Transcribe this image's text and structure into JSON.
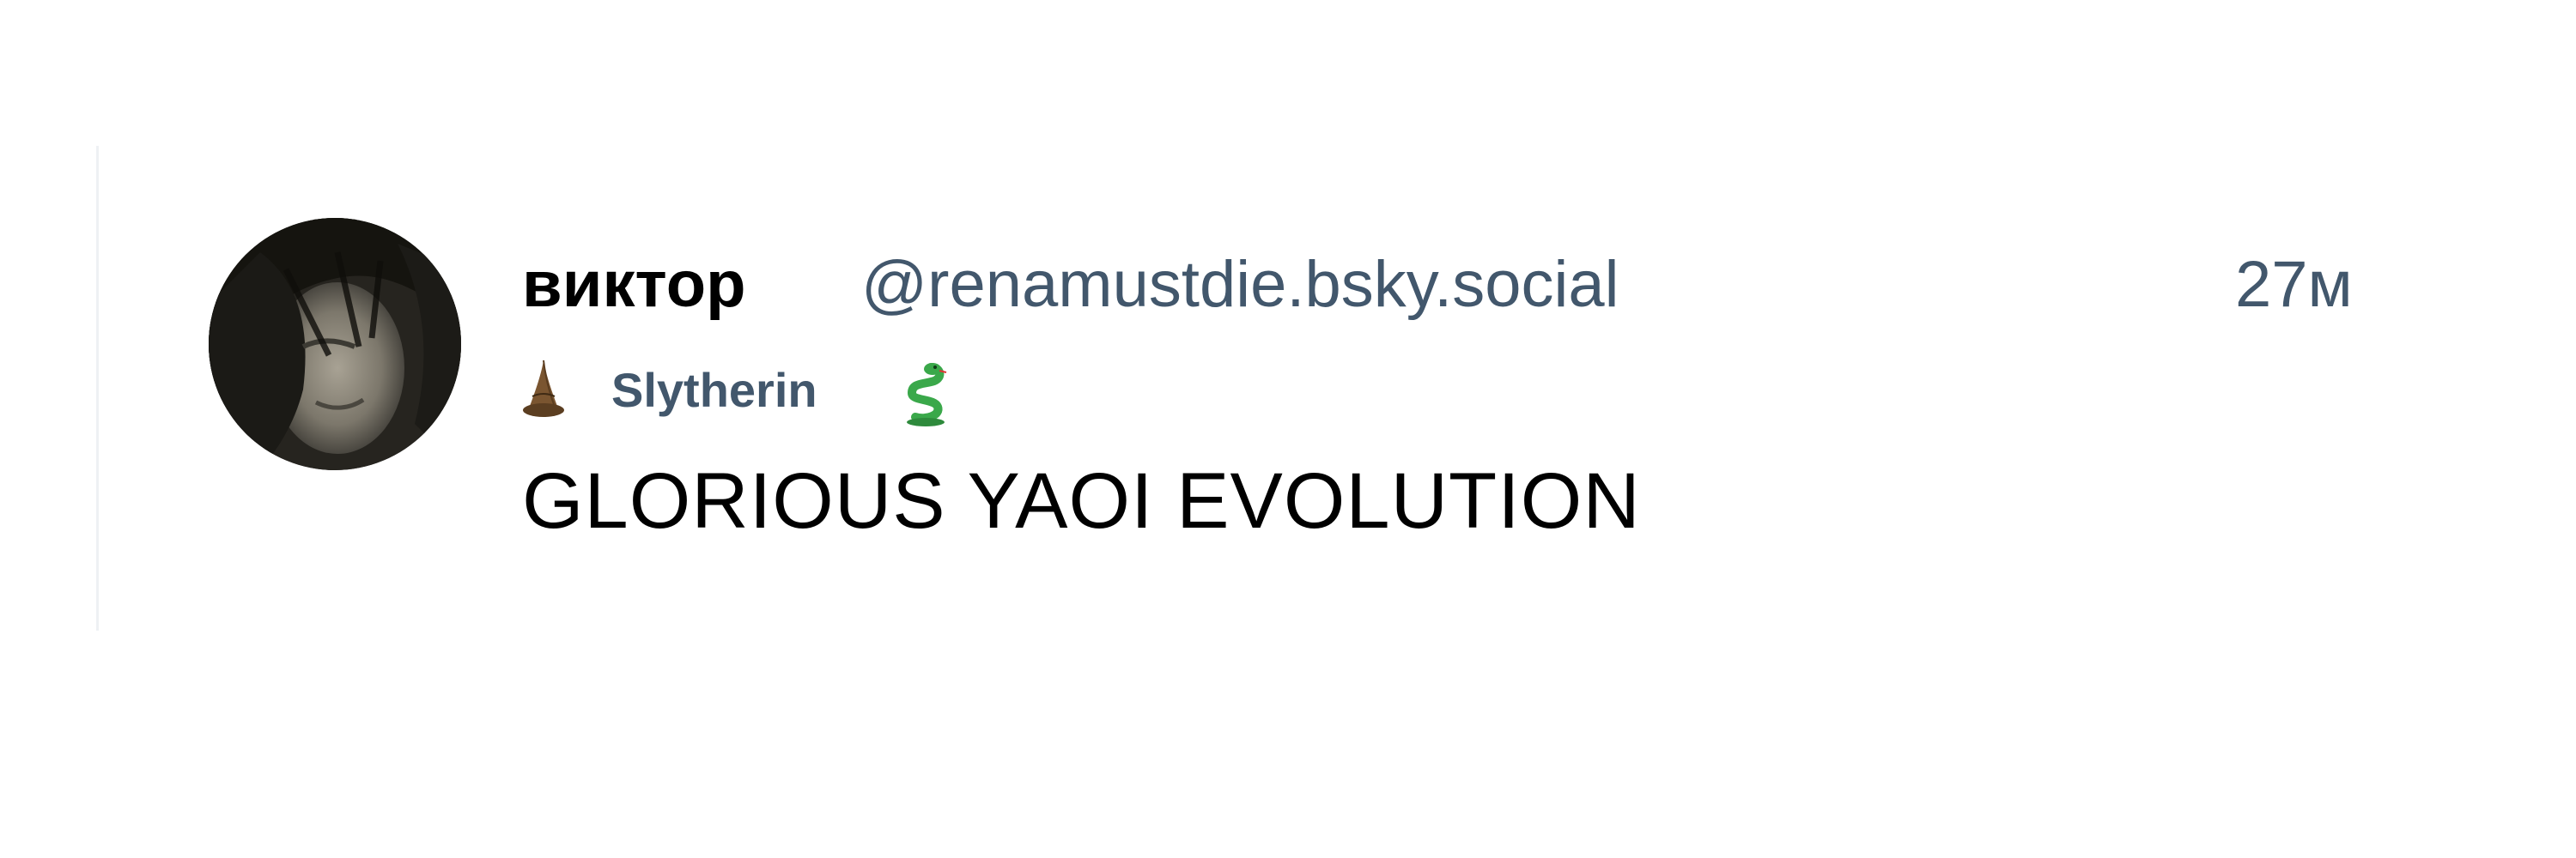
{
  "post": {
    "author": {
      "display_name": "виктор",
      "handle": "@renamustdie.bsky.social",
      "avatar_icon": "avatar-portrait"
    },
    "timestamp": "27м",
    "label": {
      "icon_left": "wizard-hat-icon",
      "text": "Slytherin",
      "icon_right": "snake-icon"
    },
    "text": "GLORIOUS YAOI EVOLUTION"
  },
  "colors": {
    "text_primary": "#000000",
    "text_secondary": "#42576c",
    "divider": "#eef1f4",
    "snake": "#3aa84a"
  }
}
